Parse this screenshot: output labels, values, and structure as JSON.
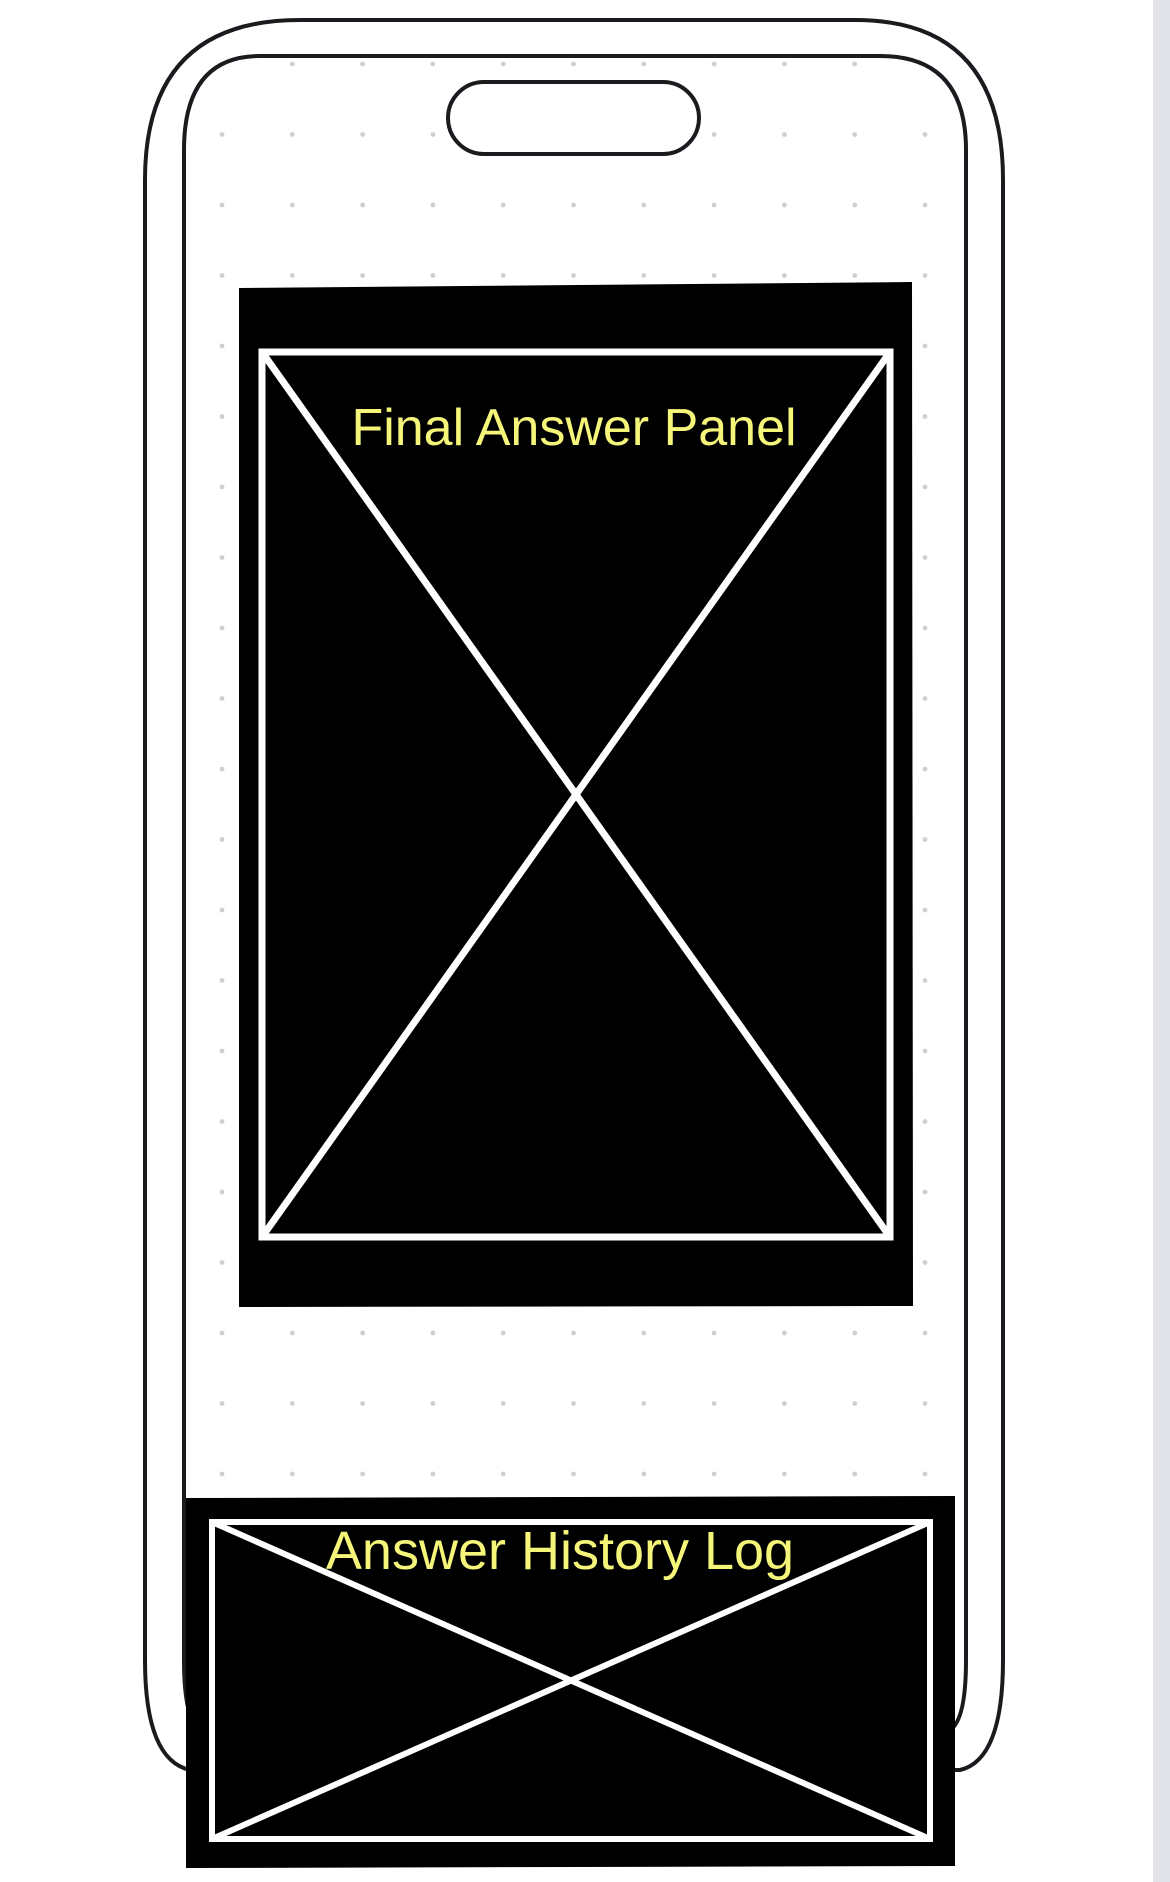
{
  "final_panel": {
    "label": "Final Answer Panel"
  },
  "history_log": {
    "label": "Answer History Log"
  },
  "colors": {
    "background": "#ffffff",
    "dot_grid": "#cfcfcf",
    "phone_outline": "#1b1b1f",
    "placeholder_fill": "#000000",
    "placeholder_lines": "#ffffff",
    "label_text": "#f5f57a",
    "edge_strip": "#e3e3ea"
  }
}
